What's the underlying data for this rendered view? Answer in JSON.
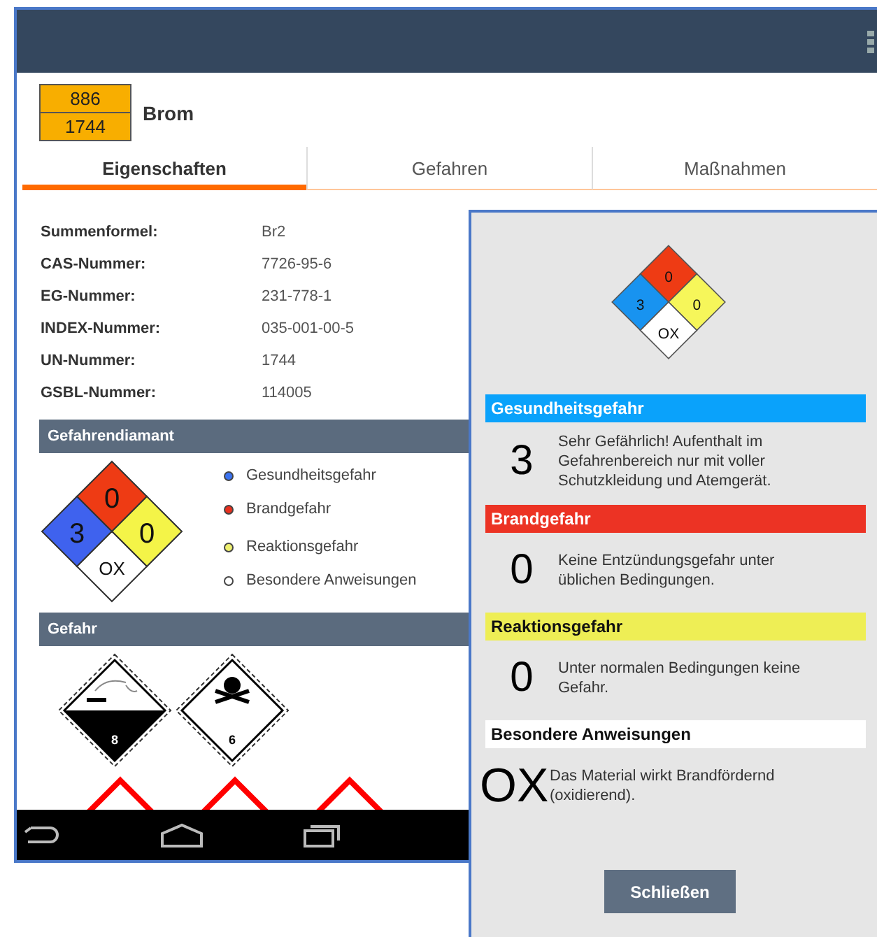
{
  "substance": {
    "hazard_number": "886",
    "un_number": "1744",
    "name": "Brom"
  },
  "tabs": [
    {
      "label": "Eigenschaften",
      "selected": true
    },
    {
      "label": "Gefahren",
      "selected": false
    },
    {
      "label": "Maßnahmen",
      "selected": false
    }
  ],
  "properties": [
    {
      "label": "Summenformel:",
      "value": "Br2"
    },
    {
      "label": "CAS-Nummer:",
      "value": "7726-95-6"
    },
    {
      "label": "EG-Nummer:",
      "value": "231-778-1"
    },
    {
      "label": "INDEX-Nummer:",
      "value": "035-001-00-5"
    },
    {
      "label": "UN-Nummer:",
      "value": "1744"
    },
    {
      "label": "GSBL-Nummer:",
      "value": "114005"
    }
  ],
  "diamond_section": {
    "title": "Gefahrendiamant",
    "diamond": {
      "health": "3",
      "fire": "0",
      "reactivity": "0",
      "special": "OX"
    },
    "legend": [
      {
        "label": "Gesundheitsgefahr",
        "color": "#3b73f0"
      },
      {
        "label": "Brandgefahr",
        "color": "#e8301e"
      },
      {
        "label": "Reaktionsgefahr",
        "color": "#eef070"
      },
      {
        "label": "Besondere Anweisungen",
        "color": "#ffffff"
      }
    ]
  },
  "hazard_section": {
    "title": "Gefahr",
    "pictograms": [
      {
        "kind": "corrosive",
        "number": "8"
      },
      {
        "kind": "toxic",
        "number": "6"
      }
    ],
    "ghs_pictograms": [
      {
        "kind": "ghs"
      },
      {
        "kind": "ghs"
      },
      {
        "kind": "ghs"
      }
    ]
  },
  "dialog": {
    "diamond": {
      "health": "3",
      "fire": "0",
      "reactivity": "0",
      "special": "OX"
    },
    "entries": [
      {
        "title": "Gesundheitsgefahr",
        "color": "#0aa2fb",
        "value": "3",
        "text": "Sehr Gefährlich! Aufenthalt im Gefahrenbereich nur mit voller Schutzkleidung und Atemgerät."
      },
      {
        "title": "Brandgefahr",
        "color": "#ec3324",
        "value": "0",
        "text": "Keine Entzündungsgefahr unter üblichen Bedingungen."
      },
      {
        "title": "Reaktionsgefahr",
        "color": "#eeee55",
        "value": "0",
        "text": "Unter normalen Bedingungen keine Gefahr."
      },
      {
        "title": "Besondere Anweisungen",
        "color": "#ffffff",
        "value": "OX",
        "text": "Das Material wirkt Brandfördernd (oxidierend)."
      }
    ],
    "button": "Schließen"
  }
}
